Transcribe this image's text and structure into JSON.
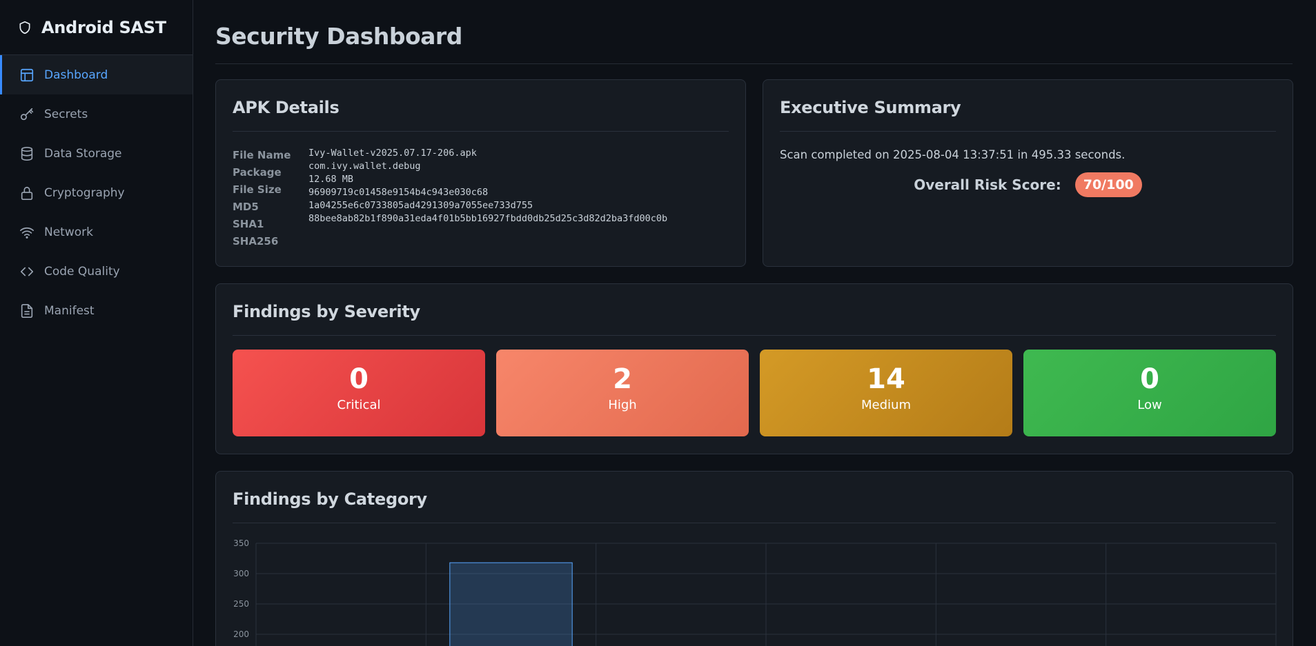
{
  "app": {
    "title": "Android SAST"
  },
  "sidebar": {
    "items": [
      {
        "label": "Dashboard",
        "icon": "layout-icon",
        "active": true
      },
      {
        "label": "Secrets",
        "icon": "key-icon"
      },
      {
        "label": "Data Storage",
        "icon": "database-icon"
      },
      {
        "label": "Cryptography",
        "icon": "lock-icon"
      },
      {
        "label": "Network",
        "icon": "wifi-icon"
      },
      {
        "label": "Code Quality",
        "icon": "code-icon"
      },
      {
        "label": "Manifest",
        "icon": "file-text-icon"
      }
    ]
  },
  "page": {
    "title": "Security Dashboard"
  },
  "apk_details": {
    "title": "APK Details",
    "labels": [
      "File Name",
      "Package",
      "File Size",
      "MD5",
      "SHA1",
      "SHA256"
    ],
    "values": [
      "Ivy-Wallet-v2025.07.17-206.apk",
      "com.ivy.wallet.debug",
      "12.68 MB",
      "96909719c01458e9154b4c943e030c68",
      "1a04255e6c0733805ad4291309a7055ee733d755",
      "88bee8ab82b1f890a31eda4f01b5bb16927fbdd0db25d25c3d82d2ba3fd00c0b"
    ]
  },
  "executive_summary": {
    "title": "Executive Summary",
    "scan_text": "Scan completed on 2025-08-04 13:37:51 in 495.33 seconds.",
    "risk_label": "Overall Risk Score:",
    "risk_score": "70/100"
  },
  "severity": {
    "title": "Findings by Severity",
    "items": [
      {
        "count": "0",
        "label": "Critical"
      },
      {
        "count": "2",
        "label": "High"
      },
      {
        "count": "14",
        "label": "Medium"
      },
      {
        "count": "0",
        "label": "Low"
      }
    ],
    "colors": {
      "critical": "#f04747",
      "high": "#f0775c",
      "medium": "#c48a1f",
      "low": "#36b04a"
    }
  },
  "category": {
    "title": "Findings by Category"
  },
  "chart_data": {
    "type": "bar",
    "title": "",
    "xlabel": "",
    "ylabel": "",
    "ylim": [
      0,
      350
    ],
    "yticks": [
      200,
      250,
      300,
      350
    ],
    "categories": [
      "",
      "",
      "",
      "",
      "",
      ""
    ],
    "values": [
      0,
      318,
      0,
      0,
      0,
      0
    ],
    "bar_color": "#58a6ff",
    "grid": true
  }
}
